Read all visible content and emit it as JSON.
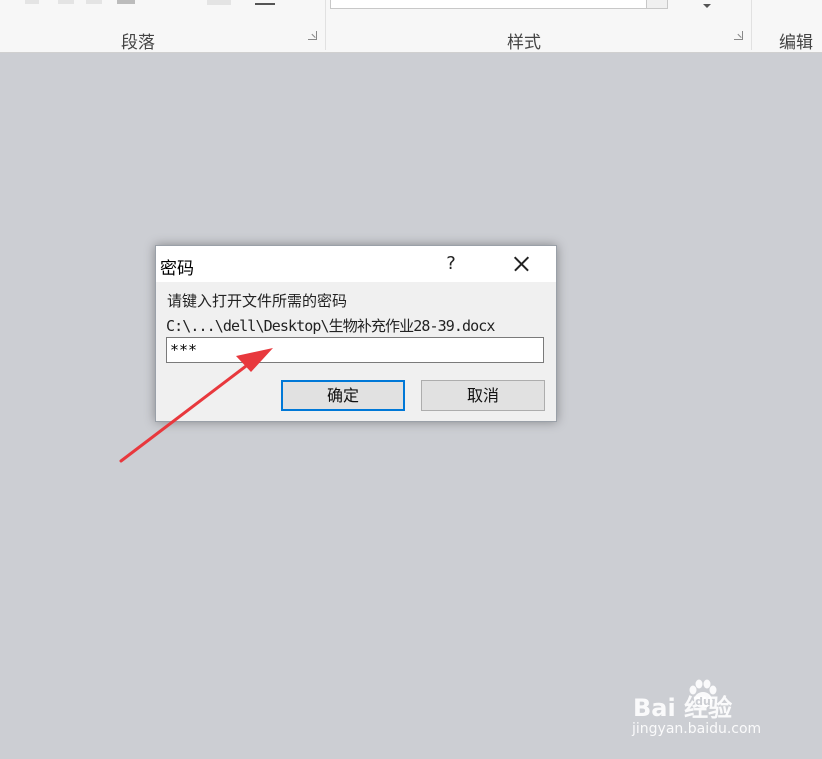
{
  "ribbon": {
    "groups": [
      {
        "label": "段落"
      },
      {
        "label": "样式"
      },
      {
        "label": "编辑"
      }
    ]
  },
  "dialog": {
    "title": "密码",
    "help_glyph": "?",
    "prompt": "请键入打开文件所需的密码",
    "file_path": "C:\\...\\dell\\Desktop\\生物补充作业28-39.docx",
    "password_value": "***",
    "ok_label": "确定",
    "cancel_label": "取消"
  },
  "annotation": {
    "arrow_color": "#e8383d"
  },
  "watermark": {
    "logo_text": "Bai  经验",
    "url": "jingyan.baidu.com"
  }
}
